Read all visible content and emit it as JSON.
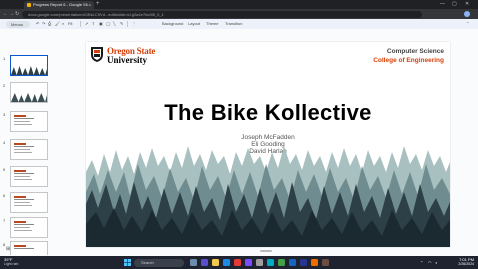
{
  "browser": {
    "tab_title": "Progress Report 6 - Google Sli...",
    "tab_close": "×",
    "new_tab": "+",
    "url": "docs.google.com/presentation/d/1BkLC9Vd...edit#slide=id.g2a4e7bc0f8_0_1",
    "back": "←",
    "forward": "→",
    "reload": "↻",
    "minimize": "—",
    "maximize": "▢",
    "close": "✕"
  },
  "toolbar": {
    "menus_label": "Menus",
    "items": [
      "Background",
      "Layout",
      "Theme",
      "Transition"
    ],
    "zoom": "Fit"
  },
  "filmstrip": {
    "slide_numbers": [
      "1",
      "2",
      "3",
      "4",
      "5",
      "6",
      "7",
      "8"
    ]
  },
  "slide": {
    "osu_line1": "Oregon State",
    "osu_line2": "University",
    "dept_line1": "Computer Science",
    "dept_line2": "College of Engineering",
    "title": "The Bike Kollective",
    "authors": [
      "Joseph McFadden",
      "Eli Gooding",
      "David Harlan"
    ]
  },
  "taskbar": {
    "temperature": "39°F",
    "weather": "Light rain",
    "search_placeholder": "Search",
    "time": "7:01 PM",
    "date": "2/26/2024"
  },
  "colors": {
    "osu_orange": "#d73f09",
    "accent_blue": "#0b57d0",
    "tree_dark": "#1e2d33",
    "tree_light": "#9fb7b8"
  }
}
